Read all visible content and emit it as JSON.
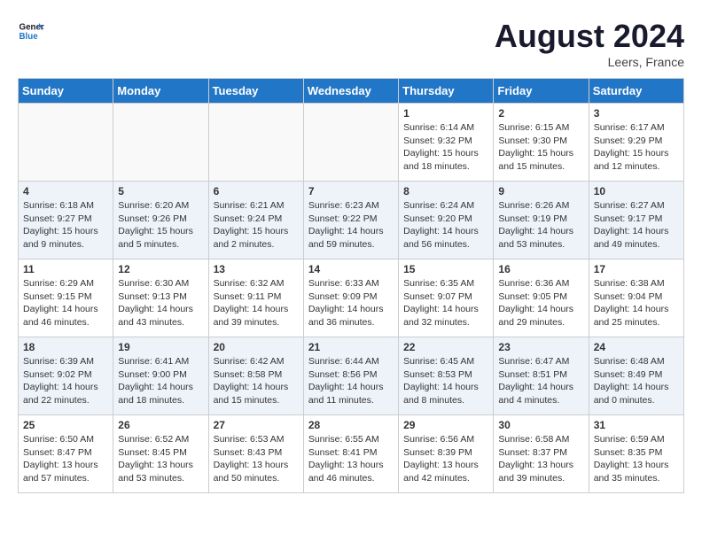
{
  "header": {
    "logo_line1": "General",
    "logo_line2": "Blue",
    "month_year": "August 2024",
    "location": "Leers, France"
  },
  "days_of_week": [
    "Sunday",
    "Monday",
    "Tuesday",
    "Wednesday",
    "Thursday",
    "Friday",
    "Saturday"
  ],
  "weeks": [
    [
      {
        "day": "",
        "empty": true
      },
      {
        "day": "",
        "empty": true
      },
      {
        "day": "",
        "empty": true
      },
      {
        "day": "",
        "empty": true
      },
      {
        "day": "1",
        "sunrise": "6:14 AM",
        "sunset": "9:32 PM",
        "daylight": "15 hours and 18 minutes."
      },
      {
        "day": "2",
        "sunrise": "6:15 AM",
        "sunset": "9:30 PM",
        "daylight": "15 hours and 15 minutes."
      },
      {
        "day": "3",
        "sunrise": "6:17 AM",
        "sunset": "9:29 PM",
        "daylight": "15 hours and 12 minutes."
      }
    ],
    [
      {
        "day": "4",
        "sunrise": "6:18 AM",
        "sunset": "9:27 PM",
        "daylight": "15 hours and 9 minutes."
      },
      {
        "day": "5",
        "sunrise": "6:20 AM",
        "sunset": "9:26 PM",
        "daylight": "15 hours and 5 minutes."
      },
      {
        "day": "6",
        "sunrise": "6:21 AM",
        "sunset": "9:24 PM",
        "daylight": "15 hours and 2 minutes."
      },
      {
        "day": "7",
        "sunrise": "6:23 AM",
        "sunset": "9:22 PM",
        "daylight": "14 hours and 59 minutes."
      },
      {
        "day": "8",
        "sunrise": "6:24 AM",
        "sunset": "9:20 PM",
        "daylight": "14 hours and 56 minutes."
      },
      {
        "day": "9",
        "sunrise": "6:26 AM",
        "sunset": "9:19 PM",
        "daylight": "14 hours and 53 minutes."
      },
      {
        "day": "10",
        "sunrise": "6:27 AM",
        "sunset": "9:17 PM",
        "daylight": "14 hours and 49 minutes."
      }
    ],
    [
      {
        "day": "11",
        "sunrise": "6:29 AM",
        "sunset": "9:15 PM",
        "daylight": "14 hours and 46 minutes."
      },
      {
        "day": "12",
        "sunrise": "6:30 AM",
        "sunset": "9:13 PM",
        "daylight": "14 hours and 43 minutes."
      },
      {
        "day": "13",
        "sunrise": "6:32 AM",
        "sunset": "9:11 PM",
        "daylight": "14 hours and 39 minutes."
      },
      {
        "day": "14",
        "sunrise": "6:33 AM",
        "sunset": "9:09 PM",
        "daylight": "14 hours and 36 minutes."
      },
      {
        "day": "15",
        "sunrise": "6:35 AM",
        "sunset": "9:07 PM",
        "daylight": "14 hours and 32 minutes."
      },
      {
        "day": "16",
        "sunrise": "6:36 AM",
        "sunset": "9:05 PM",
        "daylight": "14 hours and 29 minutes."
      },
      {
        "day": "17",
        "sunrise": "6:38 AM",
        "sunset": "9:04 PM",
        "daylight": "14 hours and 25 minutes."
      }
    ],
    [
      {
        "day": "18",
        "sunrise": "6:39 AM",
        "sunset": "9:02 PM",
        "daylight": "14 hours and 22 minutes."
      },
      {
        "day": "19",
        "sunrise": "6:41 AM",
        "sunset": "9:00 PM",
        "daylight": "14 hours and 18 minutes."
      },
      {
        "day": "20",
        "sunrise": "6:42 AM",
        "sunset": "8:58 PM",
        "daylight": "14 hours and 15 minutes."
      },
      {
        "day": "21",
        "sunrise": "6:44 AM",
        "sunset": "8:56 PM",
        "daylight": "14 hours and 11 minutes."
      },
      {
        "day": "22",
        "sunrise": "6:45 AM",
        "sunset": "8:53 PM",
        "daylight": "14 hours and 8 minutes."
      },
      {
        "day": "23",
        "sunrise": "6:47 AM",
        "sunset": "8:51 PM",
        "daylight": "14 hours and 4 minutes."
      },
      {
        "day": "24",
        "sunrise": "6:48 AM",
        "sunset": "8:49 PM",
        "daylight": "14 hours and 0 minutes."
      }
    ],
    [
      {
        "day": "25",
        "sunrise": "6:50 AM",
        "sunset": "8:47 PM",
        "daylight": "13 hours and 57 minutes."
      },
      {
        "day": "26",
        "sunrise": "6:52 AM",
        "sunset": "8:45 PM",
        "daylight": "13 hours and 53 minutes."
      },
      {
        "day": "27",
        "sunrise": "6:53 AM",
        "sunset": "8:43 PM",
        "daylight": "13 hours and 50 minutes."
      },
      {
        "day": "28",
        "sunrise": "6:55 AM",
        "sunset": "8:41 PM",
        "daylight": "13 hours and 46 minutes."
      },
      {
        "day": "29",
        "sunrise": "6:56 AM",
        "sunset": "8:39 PM",
        "daylight": "13 hours and 42 minutes."
      },
      {
        "day": "30",
        "sunrise": "6:58 AM",
        "sunset": "8:37 PM",
        "daylight": "13 hours and 39 minutes."
      },
      {
        "day": "31",
        "sunrise": "6:59 AM",
        "sunset": "8:35 PM",
        "daylight": "13 hours and 35 minutes."
      }
    ]
  ]
}
